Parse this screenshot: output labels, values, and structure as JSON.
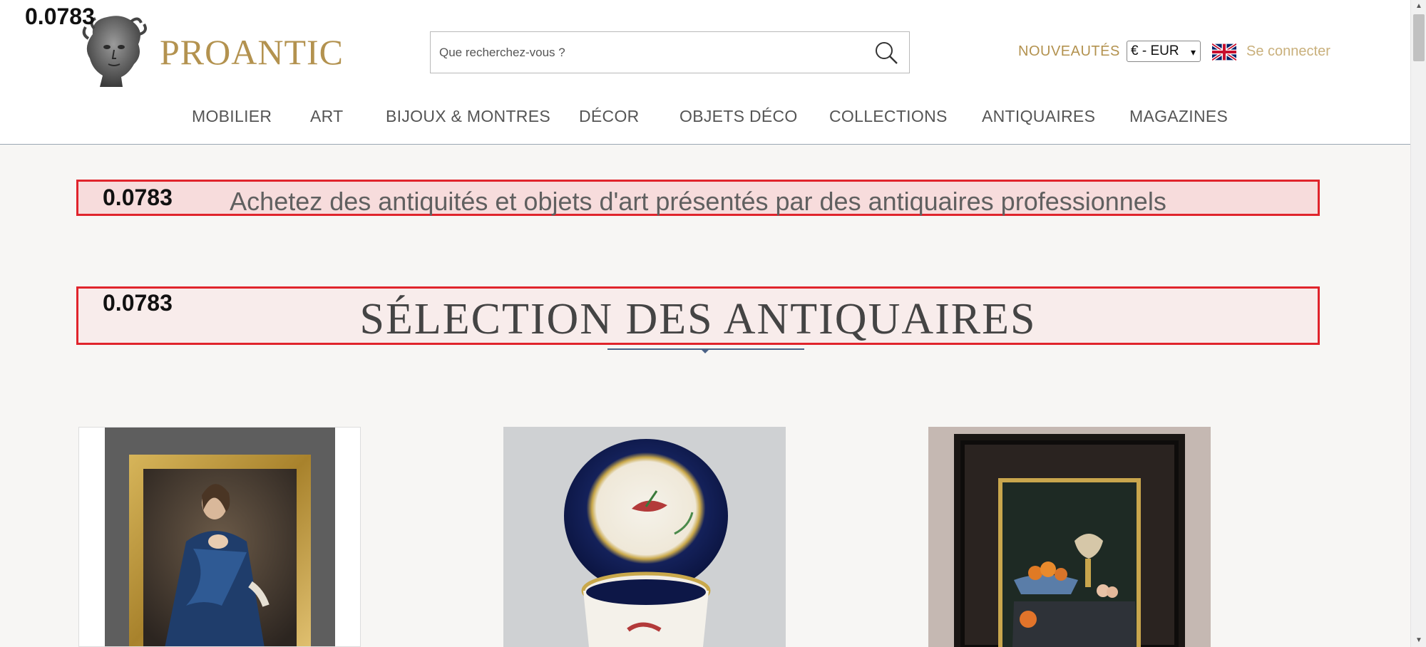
{
  "header": {
    "brand": "PROANTIC",
    "search_placeholder": "Que recherchez-vous ?",
    "nouveautes": "NOUVEAUTÉS",
    "currency": "€ - EUR",
    "login": "Se connecter",
    "icons": {
      "search": "search-icon",
      "flag": "uk-flag-icon",
      "logo": "medusa-bust-logo-icon"
    }
  },
  "nav": {
    "items": [
      "MOBILIER",
      "ART",
      "BIJOUX & MONTRES",
      "DÉCOR",
      "OBJETS DÉCO",
      "COLLECTIONS",
      "ANTIQUAIRES",
      "MAGAZINES"
    ]
  },
  "overlay": {
    "score_top": "0.0783",
    "score_hero": "0.0783",
    "score_selection": "0.0783"
  },
  "main": {
    "hero_text": "Achetez des antiquités et objets d'art présentés par des antiquaires professionnels",
    "selection_title": "SÉLECTION DES ANTIQUAIRES",
    "products": [
      {
        "image": "portrait-painting-lady-blue-dress"
      },
      {
        "image": "porcelain-cup-saucer-birds"
      },
      {
        "image": "still-life-painting-ebony-frame"
      }
    ]
  },
  "colors": {
    "brand_gold": "#b3924f",
    "overlay_red": "#e0242c",
    "divider_blue": "#4a6286"
  }
}
